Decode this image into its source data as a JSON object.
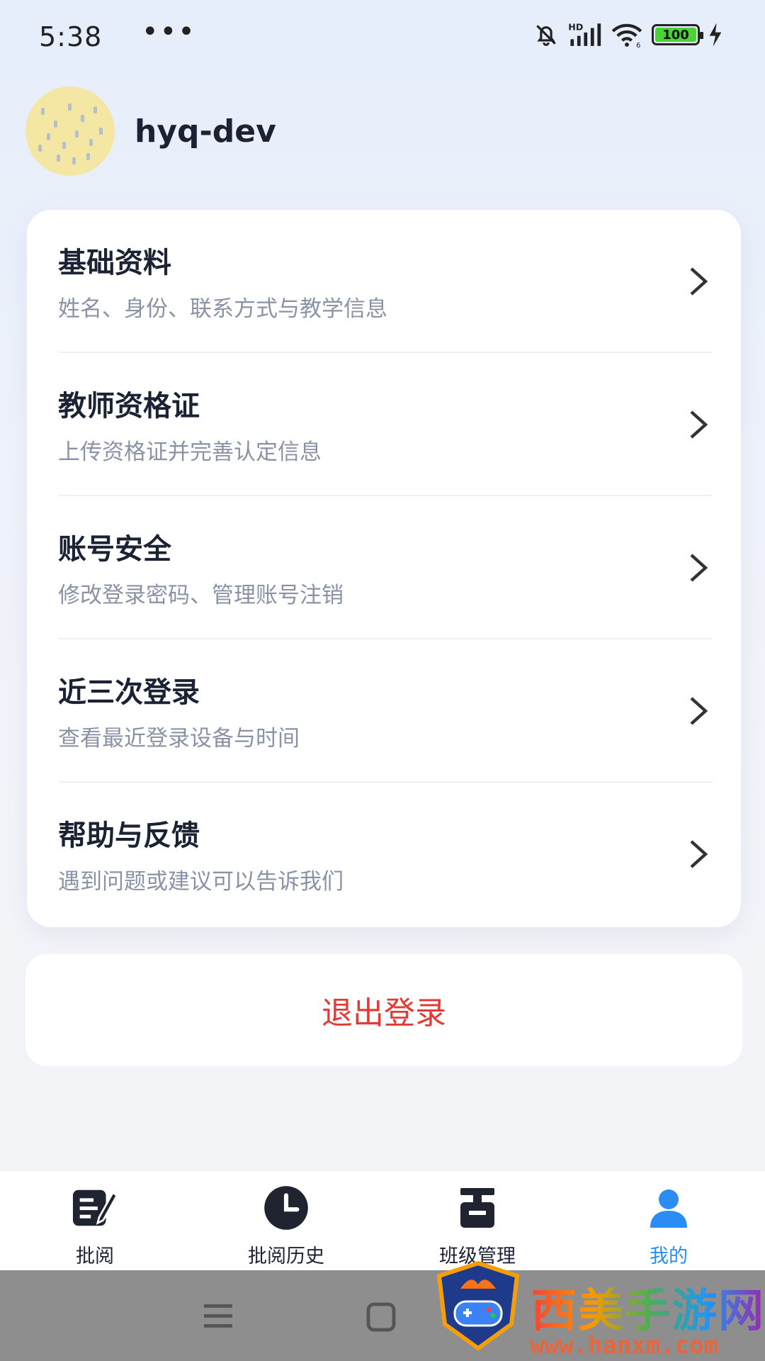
{
  "status_bar": {
    "time": "5:38",
    "more": "•••",
    "battery": "100",
    "icons": [
      "bell-muted-icon",
      "hd-signal-icon",
      "wifi-icon",
      "battery-icon",
      "charging-icon"
    ]
  },
  "profile": {
    "username": "hyq-dev"
  },
  "menu": {
    "items": [
      {
        "title": "基础资料",
        "subtitle": "姓名、身份、联系方式与教学信息"
      },
      {
        "title": "教师资格证",
        "subtitle": "上传资格证并完善认定信息"
      },
      {
        "title": "账号安全",
        "subtitle": "修改登录密码、管理账号注销"
      },
      {
        "title": "近三次登录",
        "subtitle": "查看最近登录设备与时间"
      },
      {
        "title": "帮助与反馈",
        "subtitle": "遇到问题或建议可以告诉我们"
      }
    ]
  },
  "logout": {
    "label": "退出登录",
    "color": "#e53935"
  },
  "tabbar": {
    "tabs": [
      {
        "label": "批阅",
        "icon": "edit-document-icon"
      },
      {
        "label": "批阅历史",
        "icon": "clock-icon"
      },
      {
        "label": "班级管理",
        "icon": "class-box-icon"
      },
      {
        "label": "我的",
        "icon": "person-icon",
        "active": true
      }
    ],
    "active_color": "#2b8cf4"
  },
  "watermark": {
    "title": "西美手游网",
    "url": "www.hanxm.com"
  }
}
